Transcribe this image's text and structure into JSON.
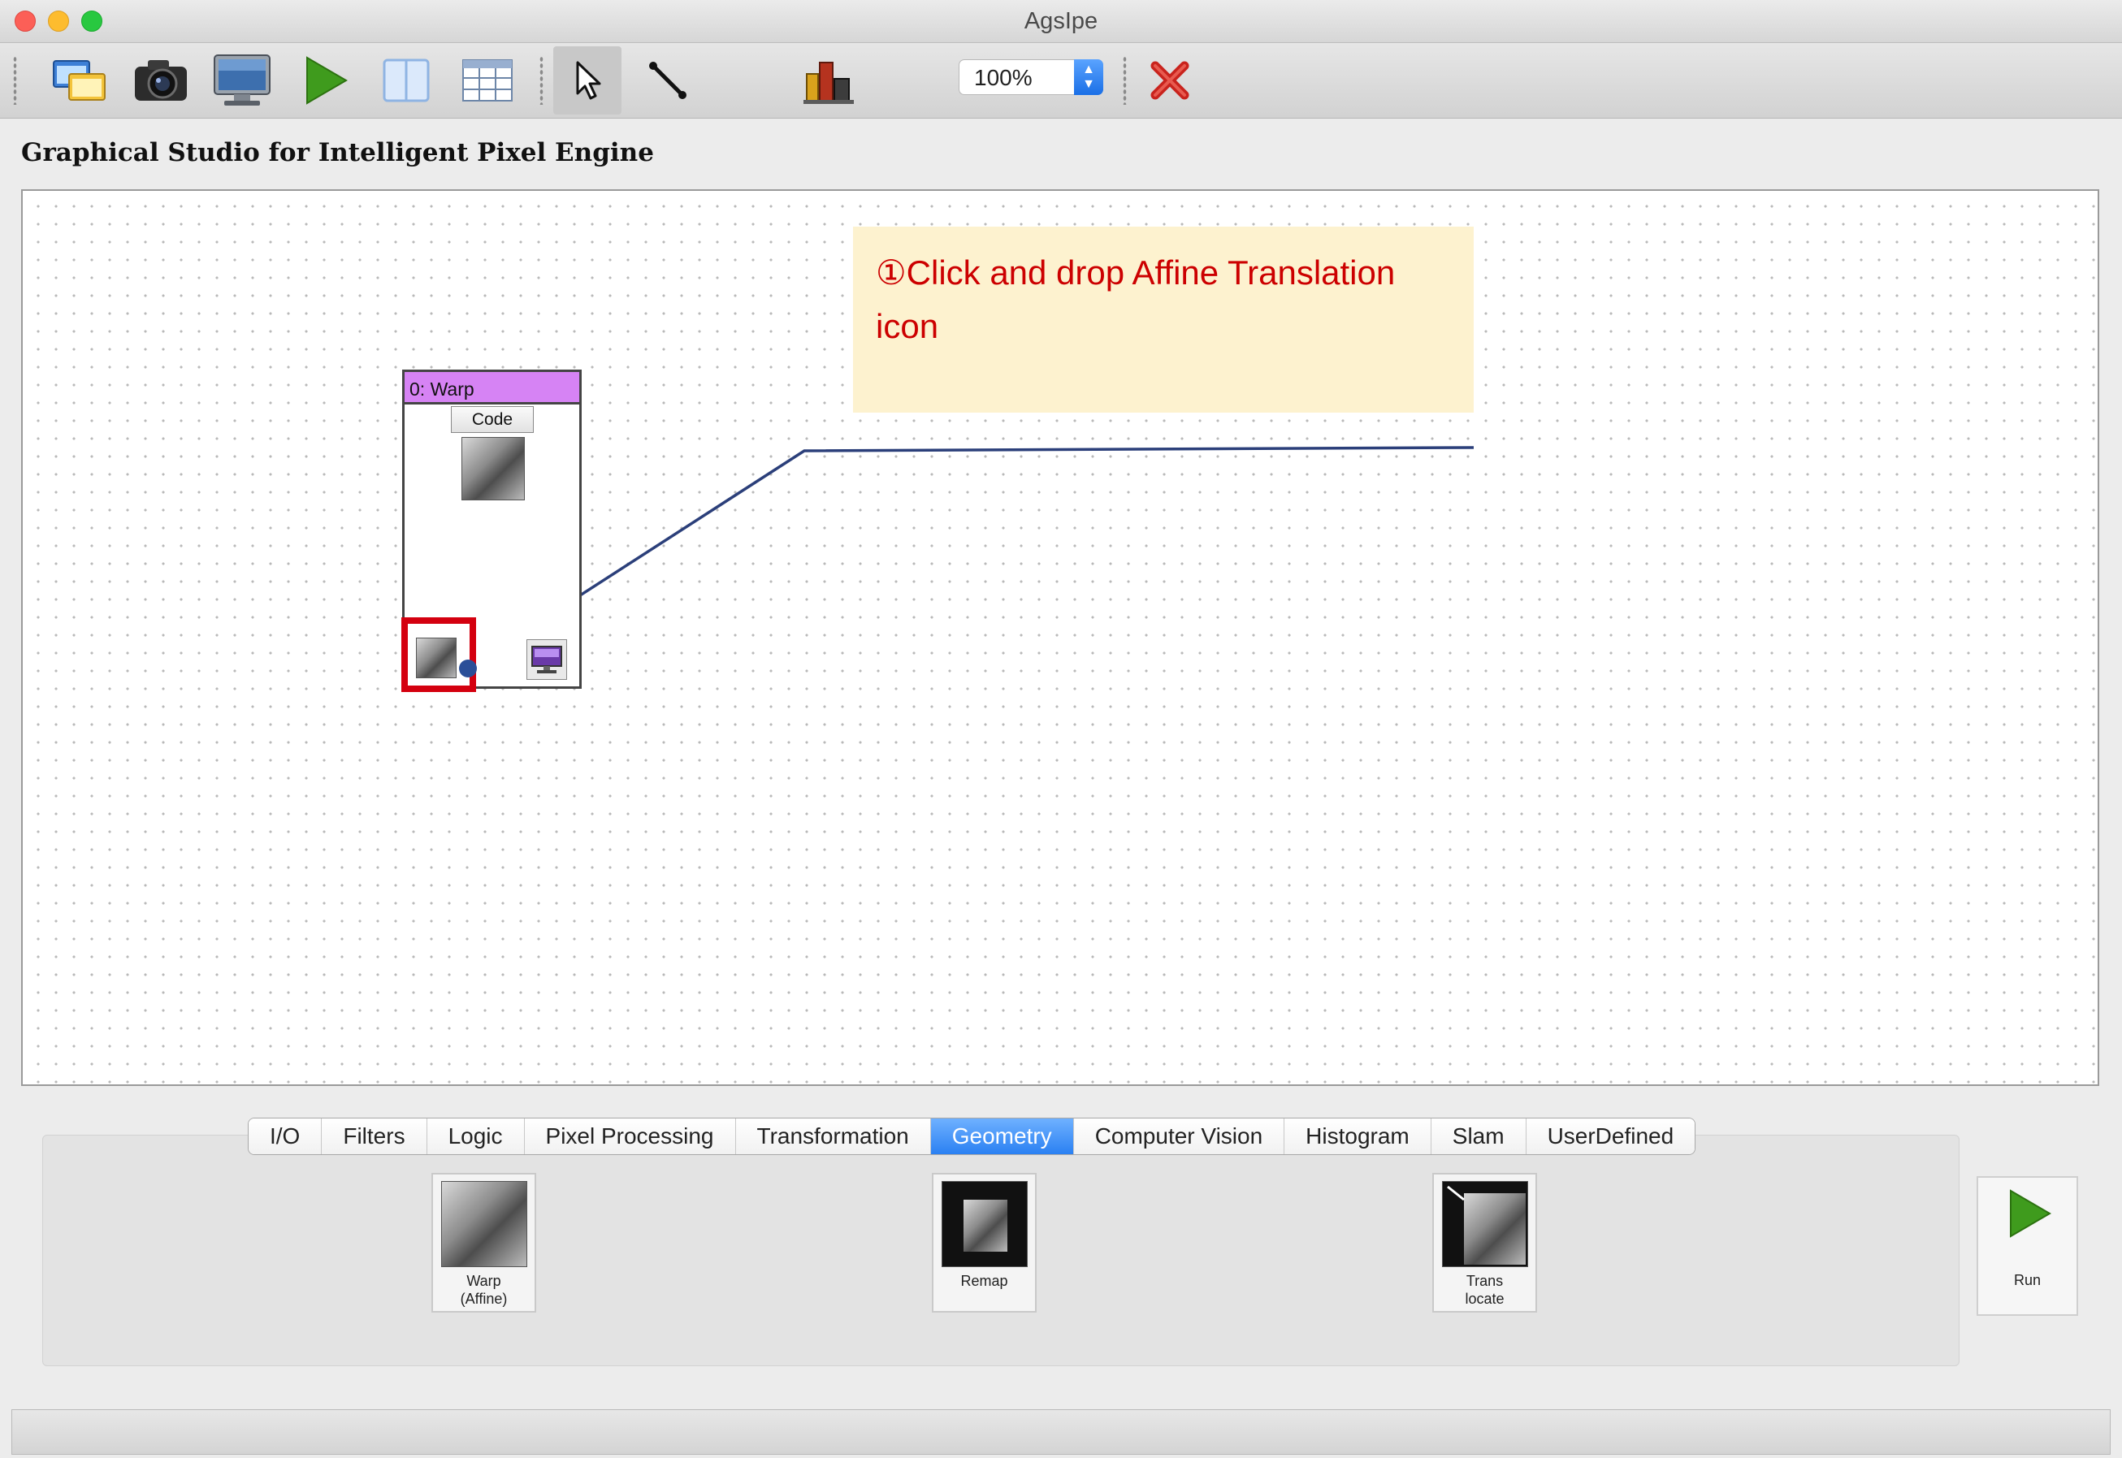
{
  "window": {
    "title": "AgsIpe"
  },
  "toolbar": {
    "buttons": [
      "windows-icon",
      "camera-icon",
      "monitor-icon",
      "run-icon",
      "split-view-icon",
      "table-icon",
      "pointer-icon",
      "connect-line-icon",
      "building-icon",
      "delete-icon"
    ],
    "zoom_value": "100%"
  },
  "heading": "Graphical Studio for Intelligent Pixel Engine",
  "note": {
    "text": "①Click and drop Affine Translation icon"
  },
  "node": {
    "title": "0: Warp",
    "code_label": "Code"
  },
  "tabs": [
    "I/O",
    "Filters",
    "Logic",
    "Pixel Processing",
    "Transformation",
    "Geometry",
    "Computer Vision",
    "Histogram",
    "Slam",
    "UserDefined"
  ],
  "active_tab": "Geometry",
  "palette": {
    "items": [
      {
        "label": "Warp\n(Affine)"
      },
      {
        "label": "Remap"
      },
      {
        "label": "Trans\nlocate"
      }
    ],
    "run_label": "Run"
  },
  "colors": {
    "accent": "#2a80f2",
    "node_header": "#d683f4",
    "highlight": "#d4000f",
    "note_bg": "#fdf2cf",
    "note_text": "#cc0000",
    "connector": "#2b3f7a"
  }
}
